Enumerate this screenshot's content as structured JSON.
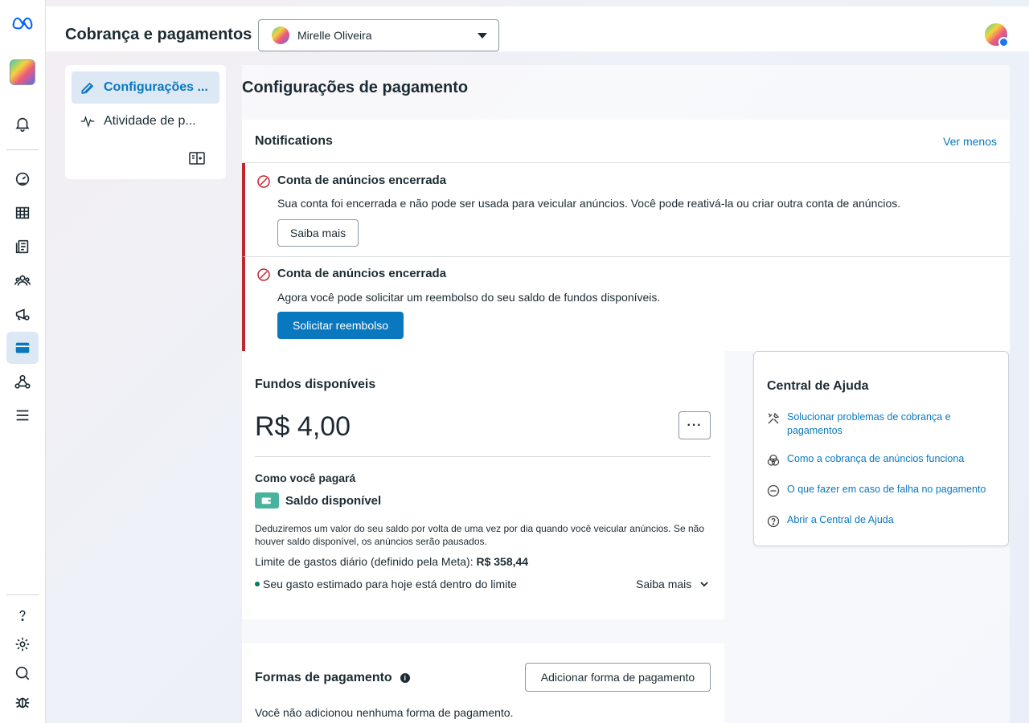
{
  "header": {
    "title": "Cobrança e pagamentos",
    "account_name": "Mirelle Oliveira"
  },
  "nav": {
    "items": [
      {
        "label": "Configurações ...",
        "icon": "pencil-icon",
        "active": true
      },
      {
        "label": "Atividade de p...",
        "icon": "activity-icon",
        "active": false
      }
    ]
  },
  "page": {
    "title": "Configurações de pagamento"
  },
  "notifications": {
    "title": "Notifications",
    "toggle_label": "Ver menos",
    "alerts": [
      {
        "title": "Conta de anúncios encerrada",
        "description": "Sua conta foi encerrada e não pode ser usada para veicular anúncios. Você pode reativá-la ou criar outra conta de anúncios.",
        "button": "Saiba mais"
      },
      {
        "title": "Conta de anúncios encerrada",
        "description": "Agora você pode solicitar um reembolso do seu saldo de fundos disponíveis.",
        "button": "Solicitar reembolso"
      }
    ]
  },
  "funds": {
    "title": "Fundos disponíveis",
    "amount": "R$ 4,00",
    "more_label": "···",
    "how_title": "Como você pagará",
    "balance_label": "Saldo disponível",
    "description": "Deduziremos um valor do seu saldo por volta de uma vez por dia quando você veicular anúncios. Se não houver saldo disponível, os anúncios serão pausados.",
    "limit_label": "Limite de gastos diário (definido pela Meta): ",
    "limit_value": "R$ 358,44",
    "estimate": "Seu gasto estimado para hoje está dentro do limite",
    "learn_more": "Saiba mais"
  },
  "help": {
    "title": "Central de Ajuda",
    "links": [
      {
        "label": "Solucionar problemas de cobrança e pagamentos",
        "icon": "tools-icon"
      },
      {
        "label": "Como a cobrança de anúncios funciona",
        "icon": "coins-icon"
      },
      {
        "label": "O que fazer em caso de falha no pagamento",
        "icon": "minus-circle-icon"
      },
      {
        "label": "Abrir a Central de Ajuda",
        "icon": "question-circle-icon"
      }
    ]
  },
  "payment_methods": {
    "title": "Formas de pagamento",
    "add_button": "Adicionar forma de pagamento",
    "empty": "Você não adicionou nenhuma forma de pagamento."
  },
  "colors": {
    "accent": "#0a78be",
    "error": "#c0272d",
    "text": "#1c2b33"
  }
}
